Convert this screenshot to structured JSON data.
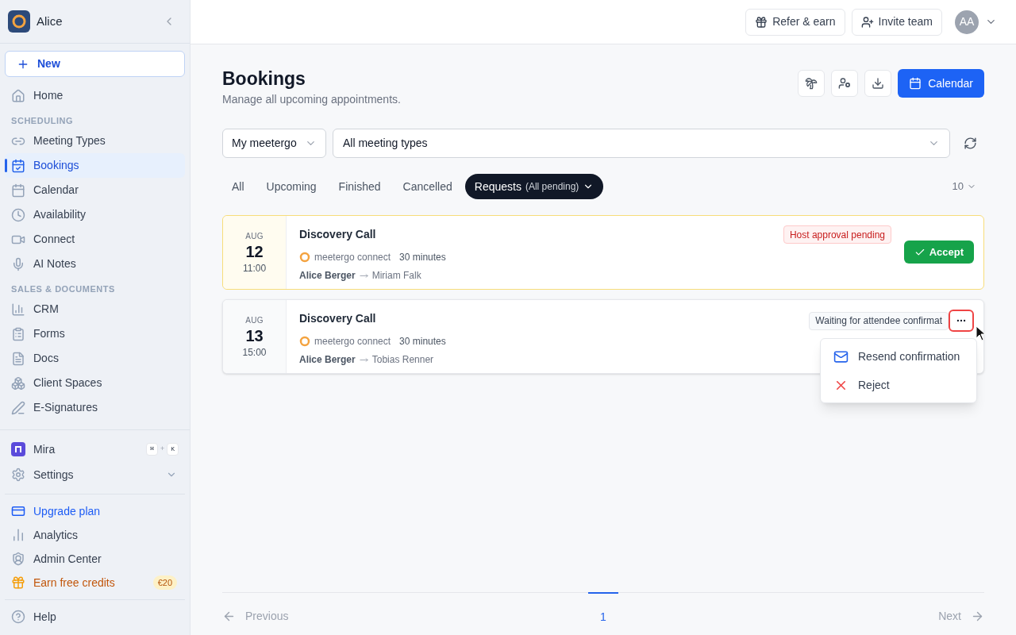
{
  "workspace": {
    "name": "Alice",
    "avatar": "AA"
  },
  "new_button": "New",
  "nav": [
    {
      "kind": "item",
      "label": "Home",
      "selected": false
    },
    {
      "kind": "section",
      "label": "SCHEDULING"
    },
    {
      "kind": "item",
      "label": "Meeting Types",
      "selected": false
    },
    {
      "kind": "item",
      "label": "Bookings",
      "selected": true
    },
    {
      "kind": "item",
      "label": "Calendar",
      "selected": false
    },
    {
      "kind": "item",
      "label": "Availability",
      "selected": false
    },
    {
      "kind": "item",
      "label": "Connect",
      "selected": false
    },
    {
      "kind": "item",
      "label": "AI Notes",
      "selected": false
    },
    {
      "kind": "section",
      "label": "SALES & DOCUMENTS"
    },
    {
      "kind": "item",
      "label": "CRM",
      "selected": false
    },
    {
      "kind": "item",
      "label": "Forms",
      "selected": false
    },
    {
      "kind": "item",
      "label": "Docs",
      "selected": false
    },
    {
      "kind": "item",
      "label": "Client Spaces",
      "selected": false
    },
    {
      "kind": "item",
      "label": "E-Signatures",
      "selected": false
    }
  ],
  "assistant": {
    "label": "Mira",
    "keys": [
      "⌘",
      "+",
      "K"
    ]
  },
  "settings": {
    "label": "Settings",
    "expanded": false
  },
  "footer_nav": [
    {
      "label": "Upgrade plan",
      "kind": "upgrade"
    },
    {
      "label": "Analytics",
      "kind": "plain"
    },
    {
      "label": "Admin Center",
      "kind": "plain"
    },
    {
      "label": "Earn free credits",
      "kind": "reward",
      "badge": "€20"
    }
  ],
  "help": "Help",
  "top_bar": {
    "buttons": [
      "Refer & earn",
      "Invite team"
    ]
  },
  "page": {
    "title": "Bookings",
    "subtitle": "Manage all upcoming appointments.",
    "calendar_button": "Calendar"
  },
  "filters": {
    "owner": "My meetergo",
    "meeting_type": "All meeting types"
  },
  "tabs": [
    {
      "label": "All",
      "selected": false
    },
    {
      "label": "Upcoming",
      "selected": false
    },
    {
      "label": "Finished",
      "selected": false
    },
    {
      "label": "Cancelled",
      "selected": false
    },
    {
      "label": "Requests",
      "note": "(All pending)",
      "selected": true
    }
  ],
  "page_size": "10",
  "bookings": [
    {
      "month": "AUG",
      "day": "12",
      "time": "11:00",
      "title": "Discovery Call",
      "location": "meetergo connect",
      "duration": "30 minutes",
      "host": "Alice Berger",
      "attendee": "Miriam Falk",
      "status": "Host approval pending",
      "kind": "approval",
      "highlighted": true,
      "action": "Accept"
    },
    {
      "month": "AUG",
      "day": "13",
      "time": "15:00",
      "title": "Discovery Call",
      "location": "meetergo connect",
      "duration": "30 minutes",
      "host": "Alice Berger",
      "attendee": "Tobias Renner",
      "status": "Waiting for attendee confirmat",
      "kind": "waiting",
      "highlighted": false,
      "menu_open": true,
      "menu": [
        {
          "label": "Resend confirmation",
          "kind": "mail"
        },
        {
          "label": "Reject",
          "kind": "reject"
        }
      ]
    }
  ],
  "pagination": {
    "previous": "Previous",
    "next": "Next",
    "pages": [
      {
        "label": "1",
        "selected": true
      }
    ]
  }
}
